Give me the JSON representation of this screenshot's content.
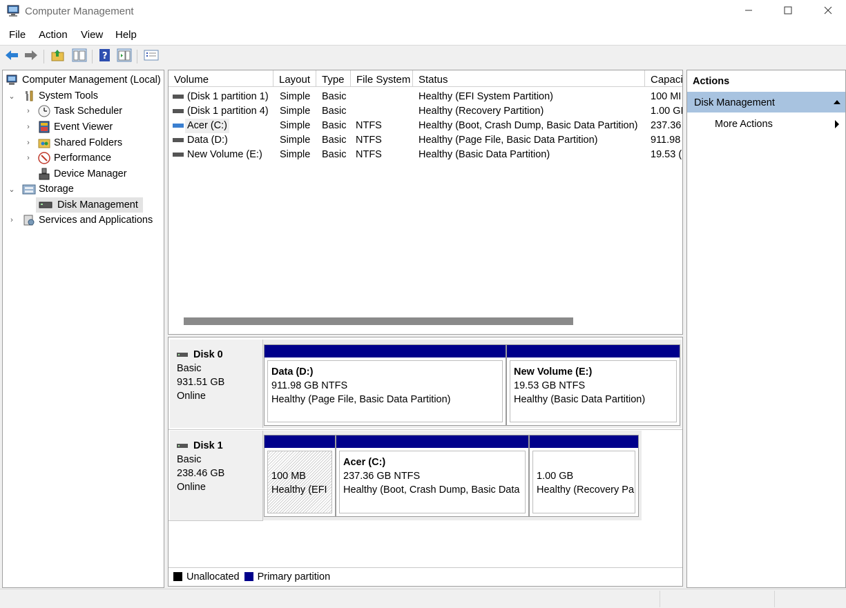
{
  "window": {
    "title": "Computer Management",
    "minimize_icon": "minimize-icon",
    "maximize_icon": "maximize-icon",
    "close_icon": "close-icon"
  },
  "menu": [
    "File",
    "Action",
    "View",
    "Help"
  ],
  "toolbar": {
    "icons": [
      "back-icon",
      "forward-icon",
      "up-folder-icon",
      "show-hide-tree-icon",
      "help-icon",
      "show-hide-action-pane-icon",
      "properties-icon"
    ]
  },
  "tree": {
    "root": "Computer Management (Local)",
    "system_tools": "System Tools",
    "task_scheduler": "Task Scheduler",
    "event_viewer": "Event Viewer",
    "shared_folders": "Shared Folders",
    "performance": "Performance",
    "device_manager": "Device Manager",
    "storage": "Storage",
    "disk_management": "Disk Management",
    "services_apps": "Services and Applications"
  },
  "volumes": {
    "columns": [
      "Volume",
      "Layout",
      "Type",
      "File System",
      "Status",
      "Capaci"
    ],
    "rows": [
      {
        "volume": "(Disk 1 partition 1)",
        "layout": "Simple",
        "type": "Basic",
        "fs": "",
        "status": "Healthy (EFI System Partition)",
        "capacity": "100 MI"
      },
      {
        "volume": "(Disk 1 partition 4)",
        "layout": "Simple",
        "type": "Basic",
        "fs": "",
        "status": "Healthy (Recovery Partition)",
        "capacity": "1.00 GI"
      },
      {
        "volume": "Acer (C:)",
        "layout": "Simple",
        "type": "Basic",
        "fs": "NTFS",
        "status": "Healthy (Boot, Crash Dump, Basic Data Partition)",
        "capacity": "237.36"
      },
      {
        "volume": "Data (D:)",
        "layout": "Simple",
        "type": "Basic",
        "fs": "NTFS",
        "status": "Healthy (Page File, Basic Data Partition)",
        "capacity": "911.98"
      },
      {
        "volume": "New Volume (E:)",
        "layout": "Simple",
        "type": "Basic",
        "fs": "NTFS",
        "status": "Healthy (Basic Data Partition)",
        "capacity": "19.53 ("
      }
    ]
  },
  "disks": {
    "disk0": {
      "name": "Disk 0",
      "type": "Basic",
      "size": "931.51 GB",
      "state": "Online",
      "parts": [
        {
          "name": "Data  (D:)",
          "size": "911.98 GB NTFS",
          "status": "Healthy (Page File, Basic Data Partition)"
        },
        {
          "name": "New Volume  (E:)",
          "size": "19.53 GB NTFS",
          "status": "Healthy (Basic Data Partition)"
        }
      ]
    },
    "disk1": {
      "name": "Disk 1",
      "type": "Basic",
      "size": "238.46 GB",
      "state": "Online",
      "parts": [
        {
          "name": "",
          "size": "100 MB",
          "status": "Healthy (EFI"
        },
        {
          "name": "Acer  (C:)",
          "size": "237.36 GB NTFS",
          "status": "Healthy (Boot, Crash Dump, Basic Data"
        },
        {
          "name": "",
          "size": "1.00 GB",
          "status": "Healthy (Recovery Pa"
        }
      ]
    }
  },
  "legend": {
    "unallocated": "Unallocated",
    "primary": "Primary partition",
    "unallocated_color": "#000000",
    "primary_color": "#00008b"
  },
  "actions": {
    "title": "Actions",
    "section": "Disk Management",
    "more": "More Actions"
  }
}
